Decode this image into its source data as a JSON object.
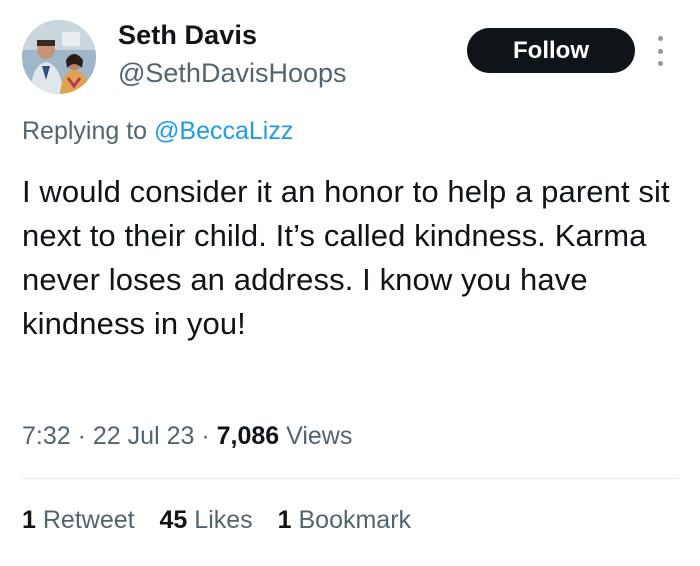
{
  "author": {
    "name": "Seth Davis",
    "handle": "@SethDavisHoops"
  },
  "actions": {
    "follow_label": "Follow",
    "more_icon": "more-vertical-icon"
  },
  "reply": {
    "prefix": "Replying to ",
    "mention": "@BeccaLizz"
  },
  "tweet": {
    "text": "I would consider it an honor to help a parent sit next to their child. It’s called kindness. Karma never loses an address. I know you have kindness in you!",
    "time": "7:32",
    "date": "22 Jul 23",
    "views_count": "7,086",
    "views_label": "Views"
  },
  "stats": {
    "retweets_count": "1",
    "retweets_label": "Retweet",
    "likes_count": "45",
    "likes_label": "Likes",
    "bookmarks_count": "1",
    "bookmarks_label": "Bookmark"
  },
  "colors": {
    "link": "#1d9bf0",
    "text": "#0f1419",
    "secondary": "#536471",
    "button_bg": "#0f1419"
  }
}
